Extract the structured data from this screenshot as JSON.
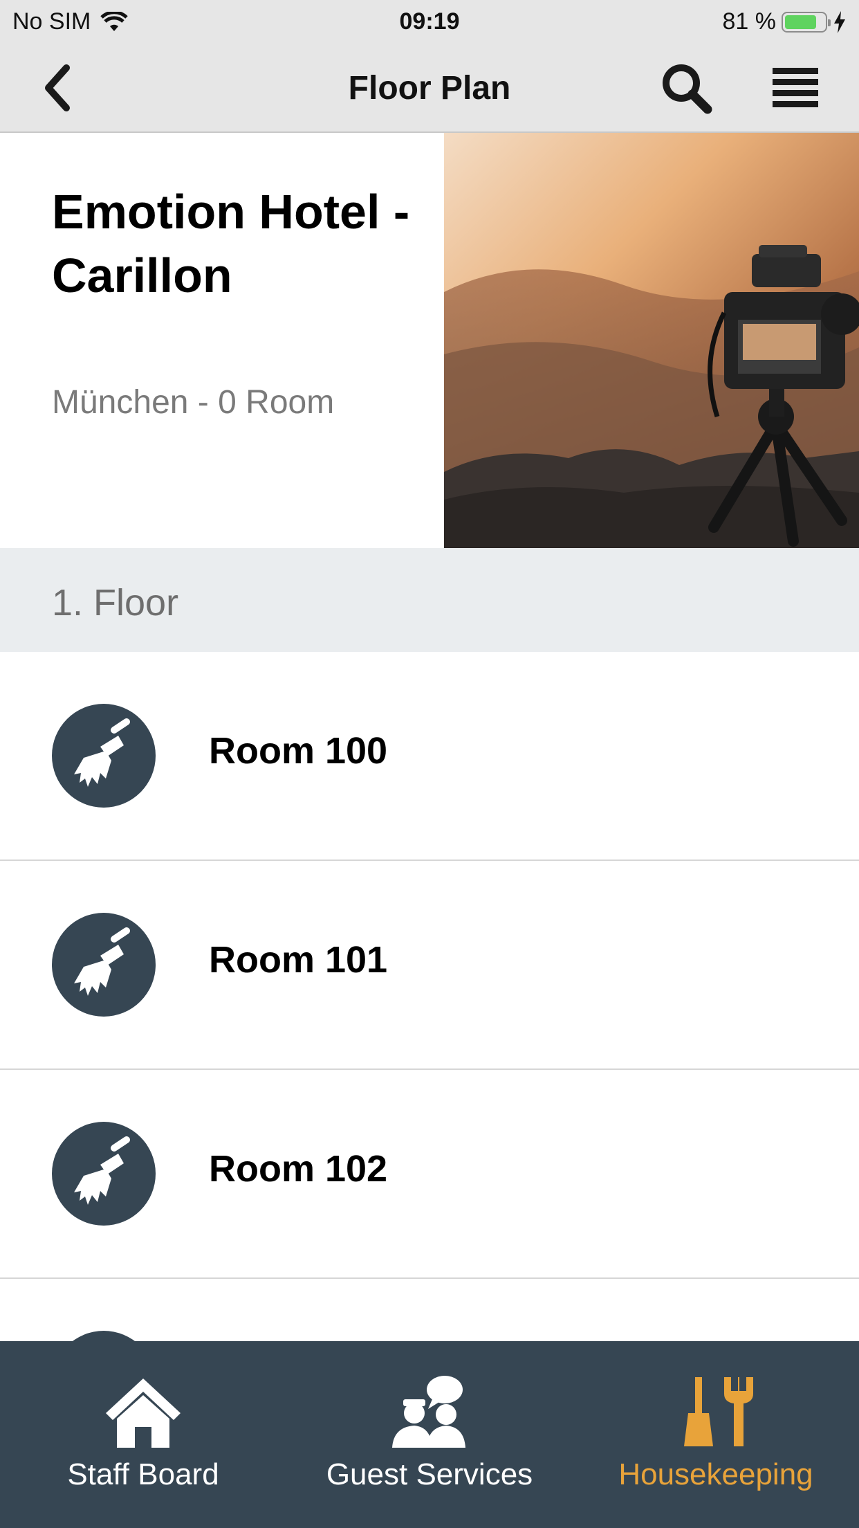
{
  "status_bar": {
    "carrier": "No SIM",
    "time": "09:19",
    "battery_text": "81 %",
    "battery_level": 0.81
  },
  "nav": {
    "title": "Floor Plan",
    "back_icon": "chevron-left-icon",
    "search_icon": "search-icon",
    "menu_icon": "menu-icon"
  },
  "hotel": {
    "name": "Emotion Hotel - Carillon",
    "subtitle": "München - 0 Room"
  },
  "floor": {
    "label": "1. Floor"
  },
  "rooms": [
    {
      "label": "Room 100",
      "icon": "broom-icon"
    },
    {
      "label": "Room 101",
      "icon": "broom-icon"
    },
    {
      "label": "Room 102",
      "icon": "broom-icon"
    },
    {
      "label": "",
      "icon": "broom-icon"
    }
  ],
  "tabs": [
    {
      "label": "Staff Board",
      "icon": "home-icon",
      "active": false
    },
    {
      "label": "Guest Services",
      "icon": "guest-services-icon",
      "active": false
    },
    {
      "label": "Housekeeping",
      "icon": "housekeeping-icon",
      "active": true
    }
  ],
  "colors": {
    "accent": "#e8a33a",
    "tabbar_bg": "#364653",
    "room_icon_bg": "#364653",
    "floor_header_bg": "#eaedef",
    "nav_bg": "#e6e6e6",
    "battery_fill": "#5fd35f"
  }
}
